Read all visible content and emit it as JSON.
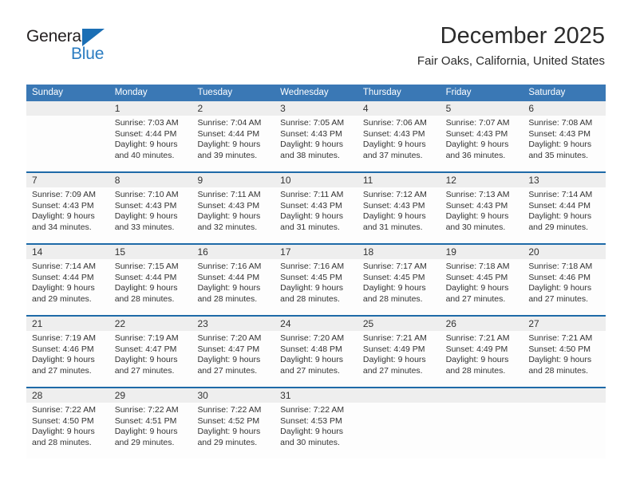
{
  "brand": {
    "name_part1": "General",
    "name_part2": "Blue",
    "accent_color": "#2b7cc1",
    "triangle_color": "#1b6fb5"
  },
  "header": {
    "title": "December 2025",
    "subtitle": "Fair Oaks, California, United States"
  },
  "calendar": {
    "header_bg": "#3a78b5",
    "separator_color": "#1e6aa8",
    "daynum_bg": "#eeeeee",
    "weekdays": [
      "Sunday",
      "Monday",
      "Tuesday",
      "Wednesday",
      "Thursday",
      "Friday",
      "Saturday"
    ],
    "weeks": [
      [
        {
          "day": "",
          "empty": true
        },
        {
          "day": "1",
          "sunrise": "Sunrise: 7:03 AM",
          "sunset": "Sunset: 4:44 PM",
          "daylight1": "Daylight: 9 hours",
          "daylight2": "and 40 minutes."
        },
        {
          "day": "2",
          "sunrise": "Sunrise: 7:04 AM",
          "sunset": "Sunset: 4:44 PM",
          "daylight1": "Daylight: 9 hours",
          "daylight2": "and 39 minutes."
        },
        {
          "day": "3",
          "sunrise": "Sunrise: 7:05 AM",
          "sunset": "Sunset: 4:43 PM",
          "daylight1": "Daylight: 9 hours",
          "daylight2": "and 38 minutes."
        },
        {
          "day": "4",
          "sunrise": "Sunrise: 7:06 AM",
          "sunset": "Sunset: 4:43 PM",
          "daylight1": "Daylight: 9 hours",
          "daylight2": "and 37 minutes."
        },
        {
          "day": "5",
          "sunrise": "Sunrise: 7:07 AM",
          "sunset": "Sunset: 4:43 PM",
          "daylight1": "Daylight: 9 hours",
          "daylight2": "and 36 minutes."
        },
        {
          "day": "6",
          "sunrise": "Sunrise: 7:08 AM",
          "sunset": "Sunset: 4:43 PM",
          "daylight1": "Daylight: 9 hours",
          "daylight2": "and 35 minutes."
        }
      ],
      [
        {
          "day": "7",
          "sunrise": "Sunrise: 7:09 AM",
          "sunset": "Sunset: 4:43 PM",
          "daylight1": "Daylight: 9 hours",
          "daylight2": "and 34 minutes."
        },
        {
          "day": "8",
          "sunrise": "Sunrise: 7:10 AM",
          "sunset": "Sunset: 4:43 PM",
          "daylight1": "Daylight: 9 hours",
          "daylight2": "and 33 minutes."
        },
        {
          "day": "9",
          "sunrise": "Sunrise: 7:11 AM",
          "sunset": "Sunset: 4:43 PM",
          "daylight1": "Daylight: 9 hours",
          "daylight2": "and 32 minutes."
        },
        {
          "day": "10",
          "sunrise": "Sunrise: 7:11 AM",
          "sunset": "Sunset: 4:43 PM",
          "daylight1": "Daylight: 9 hours",
          "daylight2": "and 31 minutes."
        },
        {
          "day": "11",
          "sunrise": "Sunrise: 7:12 AM",
          "sunset": "Sunset: 4:43 PM",
          "daylight1": "Daylight: 9 hours",
          "daylight2": "and 31 minutes."
        },
        {
          "day": "12",
          "sunrise": "Sunrise: 7:13 AM",
          "sunset": "Sunset: 4:43 PM",
          "daylight1": "Daylight: 9 hours",
          "daylight2": "and 30 minutes."
        },
        {
          "day": "13",
          "sunrise": "Sunrise: 7:14 AM",
          "sunset": "Sunset: 4:44 PM",
          "daylight1": "Daylight: 9 hours",
          "daylight2": "and 29 minutes."
        }
      ],
      [
        {
          "day": "14",
          "sunrise": "Sunrise: 7:14 AM",
          "sunset": "Sunset: 4:44 PM",
          "daylight1": "Daylight: 9 hours",
          "daylight2": "and 29 minutes."
        },
        {
          "day": "15",
          "sunrise": "Sunrise: 7:15 AM",
          "sunset": "Sunset: 4:44 PM",
          "daylight1": "Daylight: 9 hours",
          "daylight2": "and 28 minutes."
        },
        {
          "day": "16",
          "sunrise": "Sunrise: 7:16 AM",
          "sunset": "Sunset: 4:44 PM",
          "daylight1": "Daylight: 9 hours",
          "daylight2": "and 28 minutes."
        },
        {
          "day": "17",
          "sunrise": "Sunrise: 7:16 AM",
          "sunset": "Sunset: 4:45 PM",
          "daylight1": "Daylight: 9 hours",
          "daylight2": "and 28 minutes."
        },
        {
          "day": "18",
          "sunrise": "Sunrise: 7:17 AM",
          "sunset": "Sunset: 4:45 PM",
          "daylight1": "Daylight: 9 hours",
          "daylight2": "and 28 minutes."
        },
        {
          "day": "19",
          "sunrise": "Sunrise: 7:18 AM",
          "sunset": "Sunset: 4:45 PM",
          "daylight1": "Daylight: 9 hours",
          "daylight2": "and 27 minutes."
        },
        {
          "day": "20",
          "sunrise": "Sunrise: 7:18 AM",
          "sunset": "Sunset: 4:46 PM",
          "daylight1": "Daylight: 9 hours",
          "daylight2": "and 27 minutes."
        }
      ],
      [
        {
          "day": "21",
          "sunrise": "Sunrise: 7:19 AM",
          "sunset": "Sunset: 4:46 PM",
          "daylight1": "Daylight: 9 hours",
          "daylight2": "and 27 minutes."
        },
        {
          "day": "22",
          "sunrise": "Sunrise: 7:19 AM",
          "sunset": "Sunset: 4:47 PM",
          "daylight1": "Daylight: 9 hours",
          "daylight2": "and 27 minutes."
        },
        {
          "day": "23",
          "sunrise": "Sunrise: 7:20 AM",
          "sunset": "Sunset: 4:47 PM",
          "daylight1": "Daylight: 9 hours",
          "daylight2": "and 27 minutes."
        },
        {
          "day": "24",
          "sunrise": "Sunrise: 7:20 AM",
          "sunset": "Sunset: 4:48 PM",
          "daylight1": "Daylight: 9 hours",
          "daylight2": "and 27 minutes."
        },
        {
          "day": "25",
          "sunrise": "Sunrise: 7:21 AM",
          "sunset": "Sunset: 4:49 PM",
          "daylight1": "Daylight: 9 hours",
          "daylight2": "and 27 minutes."
        },
        {
          "day": "26",
          "sunrise": "Sunrise: 7:21 AM",
          "sunset": "Sunset: 4:49 PM",
          "daylight1": "Daylight: 9 hours",
          "daylight2": "and 28 minutes."
        },
        {
          "day": "27",
          "sunrise": "Sunrise: 7:21 AM",
          "sunset": "Sunset: 4:50 PM",
          "daylight1": "Daylight: 9 hours",
          "daylight2": "and 28 minutes."
        }
      ],
      [
        {
          "day": "28",
          "sunrise": "Sunrise: 7:22 AM",
          "sunset": "Sunset: 4:50 PM",
          "daylight1": "Daylight: 9 hours",
          "daylight2": "and 28 minutes."
        },
        {
          "day": "29",
          "sunrise": "Sunrise: 7:22 AM",
          "sunset": "Sunset: 4:51 PM",
          "daylight1": "Daylight: 9 hours",
          "daylight2": "and 29 minutes."
        },
        {
          "day": "30",
          "sunrise": "Sunrise: 7:22 AM",
          "sunset": "Sunset: 4:52 PM",
          "daylight1": "Daylight: 9 hours",
          "daylight2": "and 29 minutes."
        },
        {
          "day": "31",
          "sunrise": "Sunrise: 7:22 AM",
          "sunset": "Sunset: 4:53 PM",
          "daylight1": "Daylight: 9 hours",
          "daylight2": "and 30 minutes."
        },
        {
          "day": "",
          "empty": true
        },
        {
          "day": "",
          "empty": true
        },
        {
          "day": "",
          "empty": true
        }
      ]
    ]
  }
}
